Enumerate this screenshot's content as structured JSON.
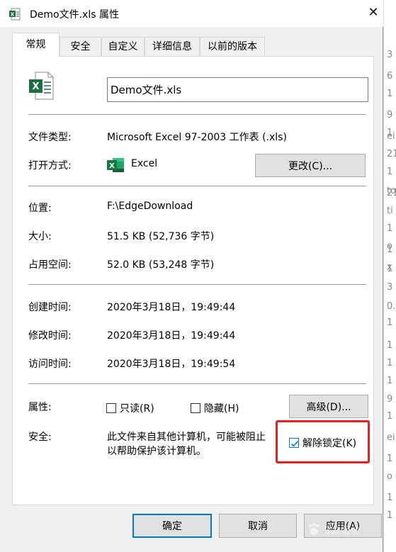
{
  "window": {
    "title": "Demo文件.xls 属性",
    "close_glyph": "✕"
  },
  "tabs": [
    {
      "label": "常规",
      "active": true
    },
    {
      "label": "安全",
      "active": false
    },
    {
      "label": "自定义",
      "active": false
    },
    {
      "label": "详细信息",
      "active": false
    },
    {
      "label": "以前的版本",
      "active": false
    }
  ],
  "general": {
    "file_name": "Demo文件.xls",
    "file_type_label": "文件类型:",
    "file_type_value": "Microsoft Excel 97-2003 工作表 (.xls)",
    "opens_with_label": "打开方式:",
    "opens_with_value": "Excel",
    "change_button": "更改(C)...",
    "location_label": "位置:",
    "location_value": "F:\\EdgeDownload",
    "size_label": "大小:",
    "size_value": "51.5 KB (52,736 字节)",
    "size_on_disk_label": "占用空间:",
    "size_on_disk_value": "52.0 KB (53,248 字节)",
    "created_label": "创建时间:",
    "created_value": "2020年3月18日，19:49:44",
    "modified_label": "修改时间:",
    "modified_value": "2020年3月18日，19:49:44",
    "accessed_label": "访问时间:",
    "accessed_value": "2020年3月18日，19:49:54",
    "attributes_label": "属性:",
    "readonly_label": "只读(R)",
    "readonly_checked": false,
    "hidden_label": "隐藏(H)",
    "hidden_checked": false,
    "advanced_button": "高级(D)...",
    "security_label": "安全:",
    "security_text_line1": "此文件来自其他计算机，可能被阻止",
    "security_text_line2": "以帮助保护该计算机。",
    "unblock_label": "解除锁定(K)",
    "unblock_checked": true
  },
  "footer": {
    "ok_button": "确定",
    "cancel_button": "取消",
    "apply_button": "应用(A)"
  },
  "watermark": {
    "text": "Bai 经验"
  },
  "background_fragments": [
    "3",
    "6",
    "1",
    "9",
    "1",
    "ei",
    "21",
    "1",
    "to",
    "21",
    "ti",
    "1",
    "o",
    "1",
    "x",
    "1",
    "3",
    "0.",
    "1",
    "1",
    "1",
    "1",
    "9",
    "1",
    "ei",
    "1",
    "o",
    "1",
    "1"
  ],
  "colors": {
    "accent": "#0078d7",
    "highlight_red": "#e8201a",
    "excel_green": "#1d6f42"
  },
  "icons": {
    "title": "excel-file-icon",
    "file": "excel-file-icon",
    "app": "excel-app-icon",
    "close": "close-icon",
    "check": "checkmark-icon"
  }
}
